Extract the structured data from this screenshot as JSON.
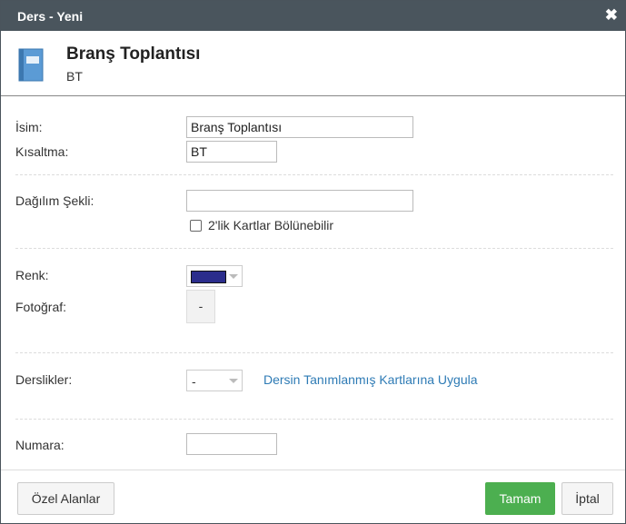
{
  "dialog": {
    "title": "Ders - Yeni",
    "close_icon": "✖"
  },
  "header": {
    "icon": "book-icon",
    "name": "Branş Toplantısı",
    "abbreviation": "BT"
  },
  "form": {
    "name_label": "İsim:",
    "name_value": "Branş Toplantısı",
    "abbr_label": "Kısaltma:",
    "abbr_value": "BT",
    "distribution_label": "Dağılım Şekli:",
    "distribution_value": "",
    "split_cards_label": "2'lik Kartlar Bölünebilir",
    "split_cards_checked": false,
    "color_label": "Renk:",
    "color_value": "#2b2d8c",
    "photo_label": "Fotoğraf:",
    "photo_button": "-",
    "classrooms_label": "Derslikler:",
    "classrooms_value": "-",
    "apply_link": "Dersin Tanımlanmış Kartlarına Uygula",
    "number_label": "Numara:",
    "number_value": ""
  },
  "footer": {
    "custom_fields_label": "Özel Alanlar",
    "ok_label": "Tamam",
    "cancel_label": "İptal"
  }
}
